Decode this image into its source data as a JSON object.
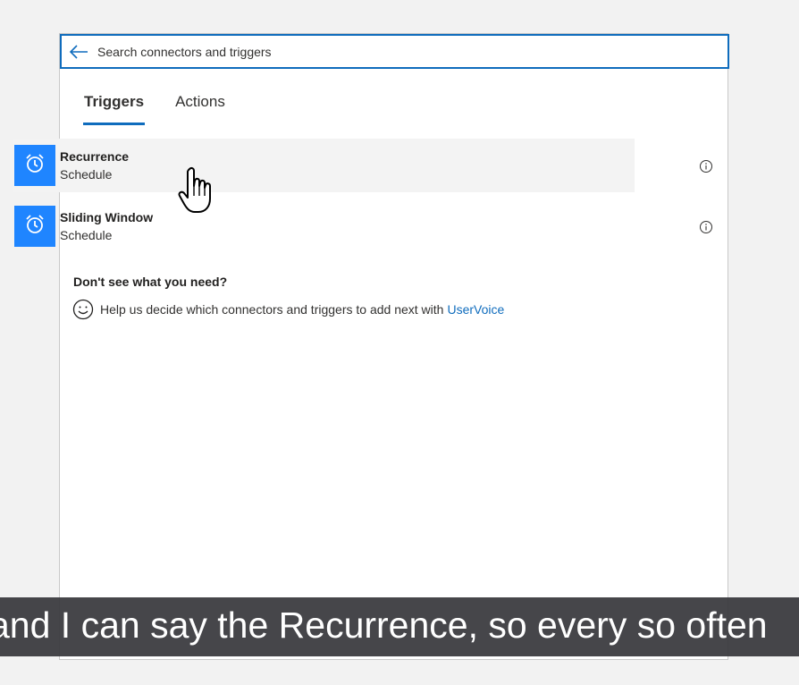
{
  "search": {
    "placeholder": "Search connectors and triggers"
  },
  "tabs": [
    {
      "label": "Triggers",
      "active": true
    },
    {
      "label": "Actions",
      "active": false
    }
  ],
  "results": [
    {
      "name": "Recurrence",
      "connector": "Schedule",
      "icon": "alarm-clock-icon",
      "hovered": true
    },
    {
      "name": "Sliding Window",
      "connector": "Schedule",
      "icon": "alarm-clock-icon",
      "hovered": false
    }
  ],
  "help": {
    "title": "Don't see what you need?",
    "text": "Help us decide which connectors and triggers to add next with",
    "link": "UserVoice"
  },
  "caption": "and I can say the Recurrence, so every so often",
  "colors": {
    "accent": "#0f6cbd",
    "tile": "#1f85ff",
    "caption_bg": "#38383c"
  }
}
